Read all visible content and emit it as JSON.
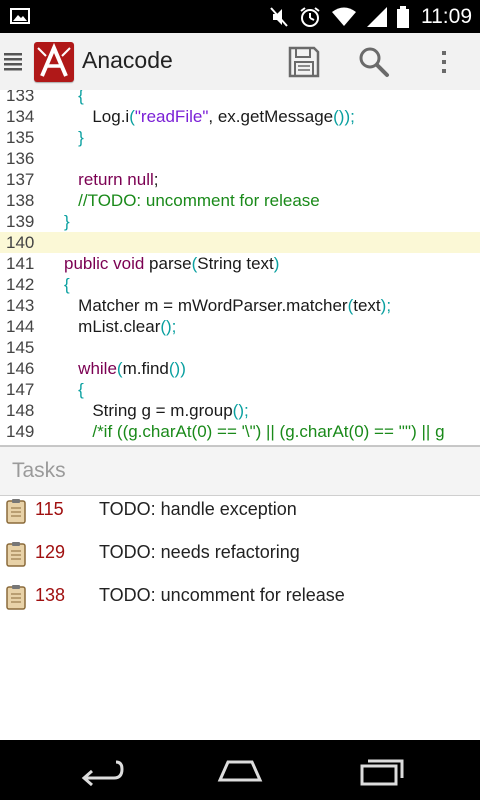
{
  "status_bar": {
    "time": "11:09",
    "icons": [
      "image-notification-icon",
      "mute-icon",
      "alarm-icon",
      "wifi-icon",
      "signal-icon",
      "battery-icon"
    ]
  },
  "action_bar": {
    "title": "Anacode",
    "logo_letter": "A",
    "brand_color": "#b01818",
    "actions": [
      "save-icon",
      "search-icon",
      "overflow-menu-icon"
    ]
  },
  "editor": {
    "lines": [
      {
        "n": "133",
        "tokens": [
          {
            "t": "   ",
            "c": ""
          },
          {
            "t": "{",
            "c": "br"
          }
        ]
      },
      {
        "n": "134",
        "tokens": [
          {
            "t": "      Log.i",
            "c": ""
          },
          {
            "t": "(",
            "c": "br"
          },
          {
            "t": "\"readFile\"",
            "c": "str"
          },
          {
            "t": ", ex.getMessage",
            "c": ""
          },
          {
            "t": "());",
            "c": "br"
          }
        ]
      },
      {
        "n": "135",
        "tokens": [
          {
            "t": "   ",
            "c": ""
          },
          {
            "t": "}",
            "c": "br"
          }
        ]
      },
      {
        "n": "136",
        "tokens": []
      },
      {
        "n": "137",
        "tokens": [
          {
            "t": "   ",
            "c": ""
          },
          {
            "t": "return null",
            "c": "kw"
          },
          {
            "t": ";",
            "c": ""
          }
        ]
      },
      {
        "n": "138",
        "tokens": [
          {
            "t": "   ",
            "c": ""
          },
          {
            "t": "//TODO: uncomment for release",
            "c": "cmt"
          }
        ]
      },
      {
        "n": "139",
        "tokens": [
          {
            "t": "}",
            "c": "br"
          }
        ]
      },
      {
        "n": "140",
        "tokens": [],
        "current": true
      },
      {
        "n": "141",
        "tokens": [
          {
            "t": "public void",
            "c": "kw"
          },
          {
            "t": " parse",
            "c": ""
          },
          {
            "t": "(",
            "c": "br"
          },
          {
            "t": "String text",
            "c": ""
          },
          {
            "t": ")",
            "c": "br"
          }
        ]
      },
      {
        "n": "142",
        "tokens": [
          {
            "t": "{",
            "c": "br"
          }
        ]
      },
      {
        "n": "143",
        "tokens": [
          {
            "t": "   Matcher m = mWordParser.matcher",
            "c": ""
          },
          {
            "t": "(",
            "c": "br"
          },
          {
            "t": "text",
            "c": ""
          },
          {
            "t": ");",
            "c": "br"
          }
        ]
      },
      {
        "n": "144",
        "tokens": [
          {
            "t": "   mList.clear",
            "c": ""
          },
          {
            "t": "();",
            "c": "br"
          }
        ]
      },
      {
        "n": "145",
        "tokens": []
      },
      {
        "n": "146",
        "tokens": [
          {
            "t": "   ",
            "c": ""
          },
          {
            "t": "while",
            "c": "kw"
          },
          {
            "t": "(",
            "c": "br"
          },
          {
            "t": "m.find",
            "c": ""
          },
          {
            "t": "())",
            "c": "br"
          }
        ]
      },
      {
        "n": "147",
        "tokens": [
          {
            "t": "   ",
            "c": ""
          },
          {
            "t": "{",
            "c": "br"
          }
        ]
      },
      {
        "n": "148",
        "tokens": [
          {
            "t": "      String g = m.group",
            "c": ""
          },
          {
            "t": "();",
            "c": "br"
          }
        ]
      },
      {
        "n": "149",
        "tokens": [
          {
            "t": "      ",
            "c": ""
          },
          {
            "t": "/*if ((g.charAt(0) == '\\\") || (g.charAt(0) == '\"') || g",
            "c": "cmt"
          }
        ]
      }
    ]
  },
  "tasks": {
    "title": "Tasks",
    "items": [
      {
        "line": "115",
        "text": "TODO: handle exception"
      },
      {
        "line": "129",
        "text": "TODO: needs refactoring"
      },
      {
        "line": "138",
        "text": "TODO: uncomment for release"
      }
    ]
  },
  "nav_bar": {
    "buttons": [
      "back-icon",
      "home-icon",
      "recents-icon"
    ]
  }
}
